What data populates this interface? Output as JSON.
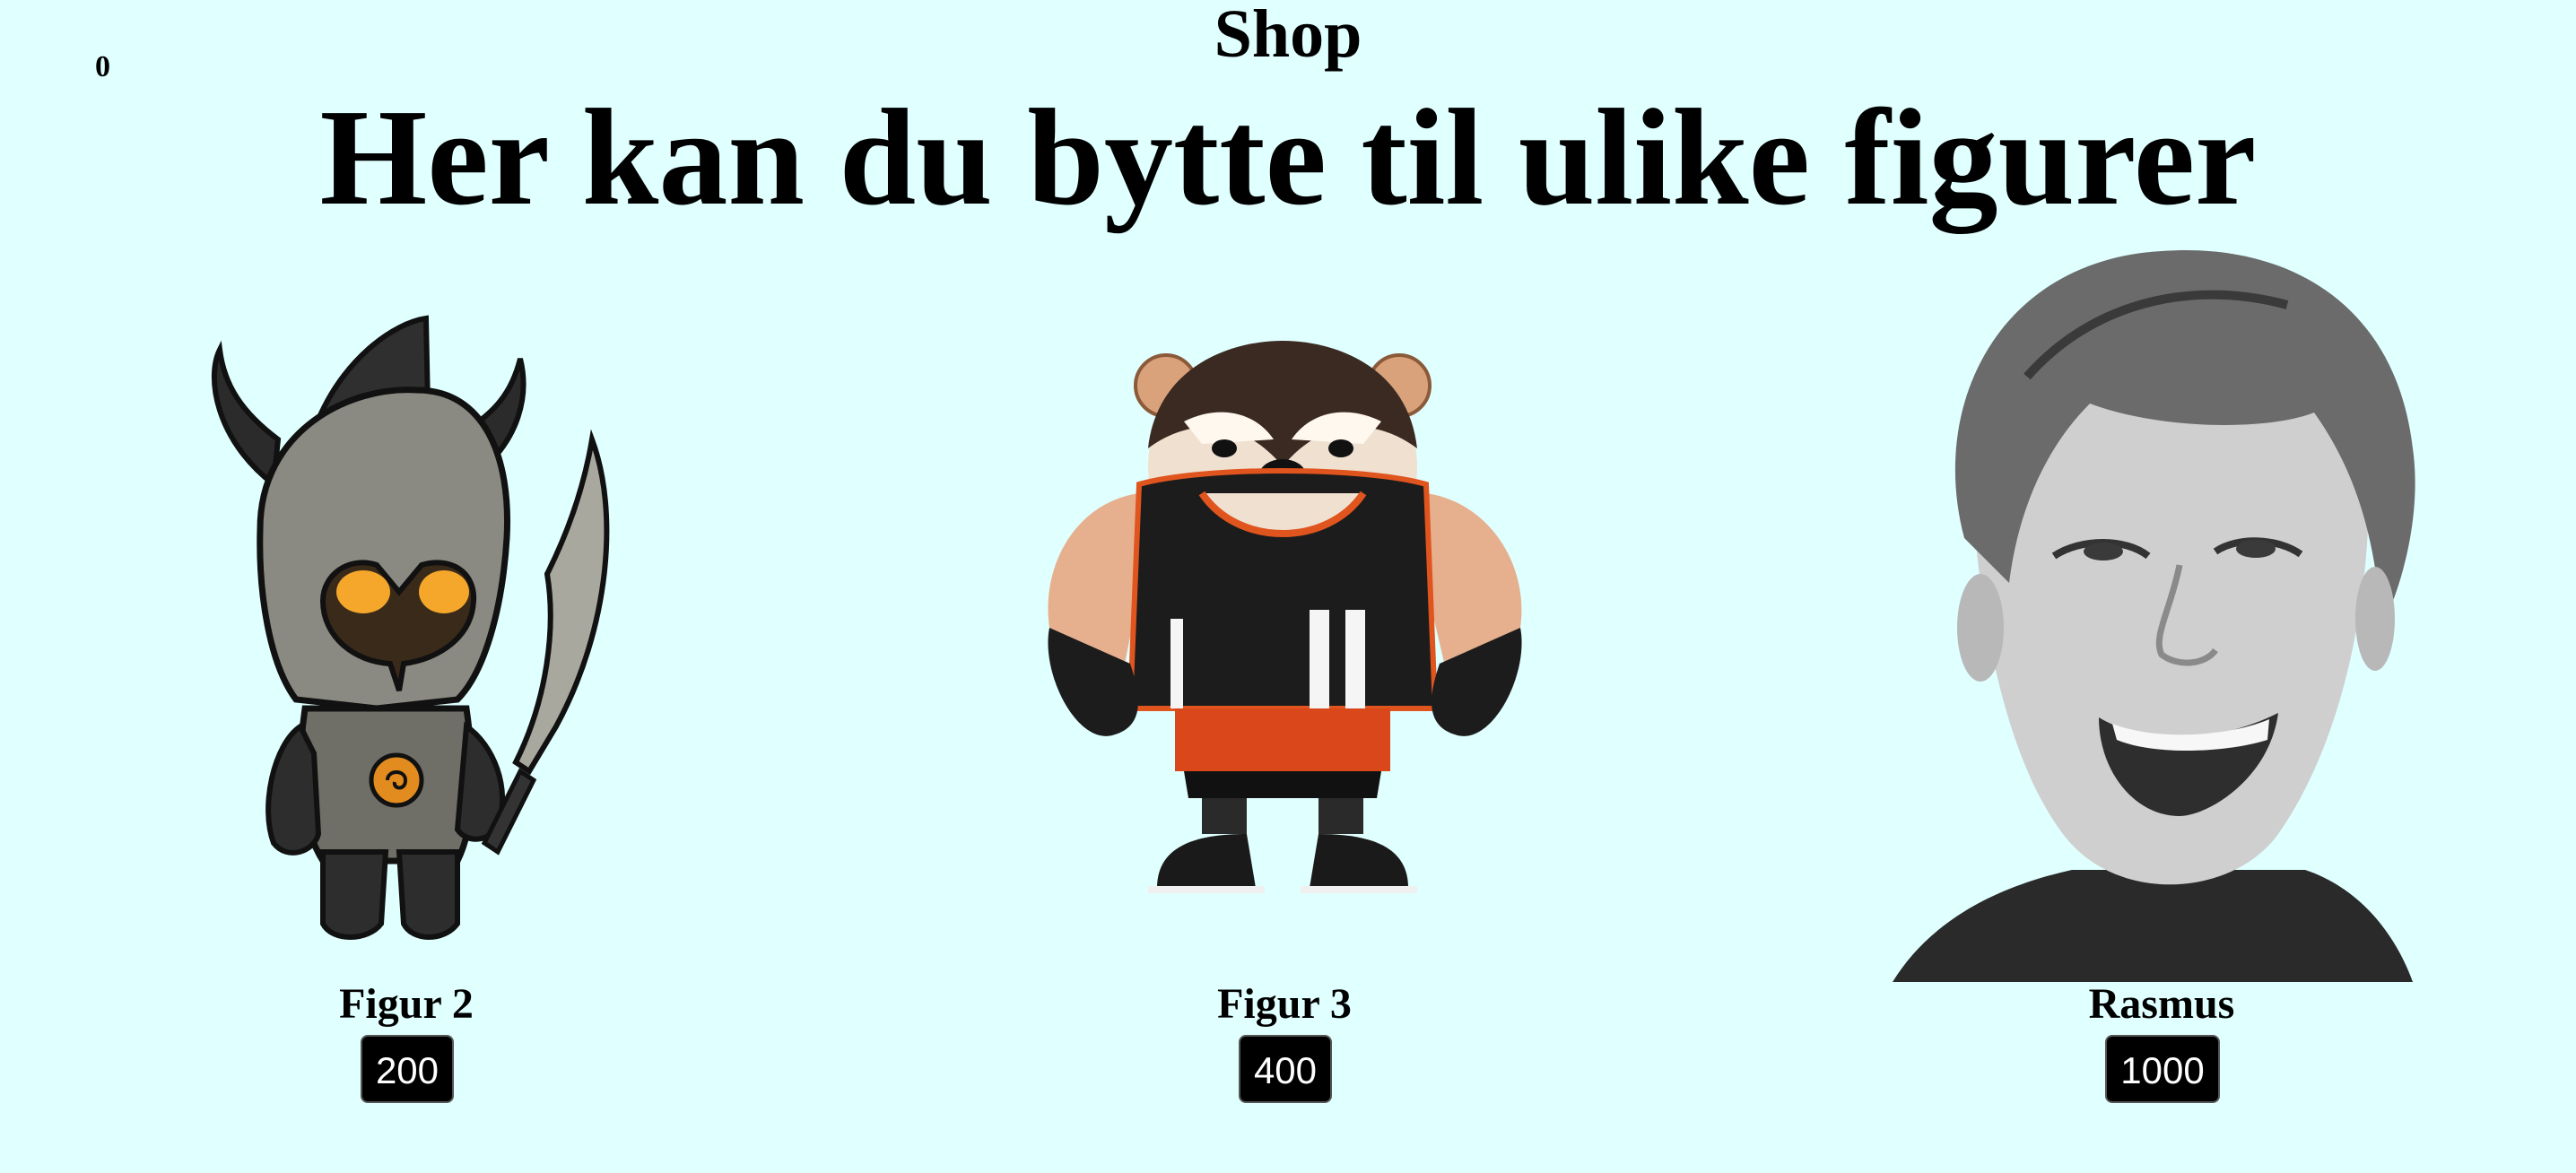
{
  "header": {
    "coins": "0",
    "title": "Shop",
    "subtitle": "Her kan du bytte til ulike figurer"
  },
  "items": [
    {
      "name": "Figur 2",
      "price": "200",
      "image": "horned-knight-figure"
    },
    {
      "name": "Figur 3",
      "price": "400",
      "image": "bear-athlete-figure"
    },
    {
      "name": "Rasmus",
      "price": "1000",
      "image": "person-portrait-photo"
    }
  ],
  "colors": {
    "background": "#e0ffff",
    "button": "#000000",
    "button_text": "#ffffff"
  }
}
